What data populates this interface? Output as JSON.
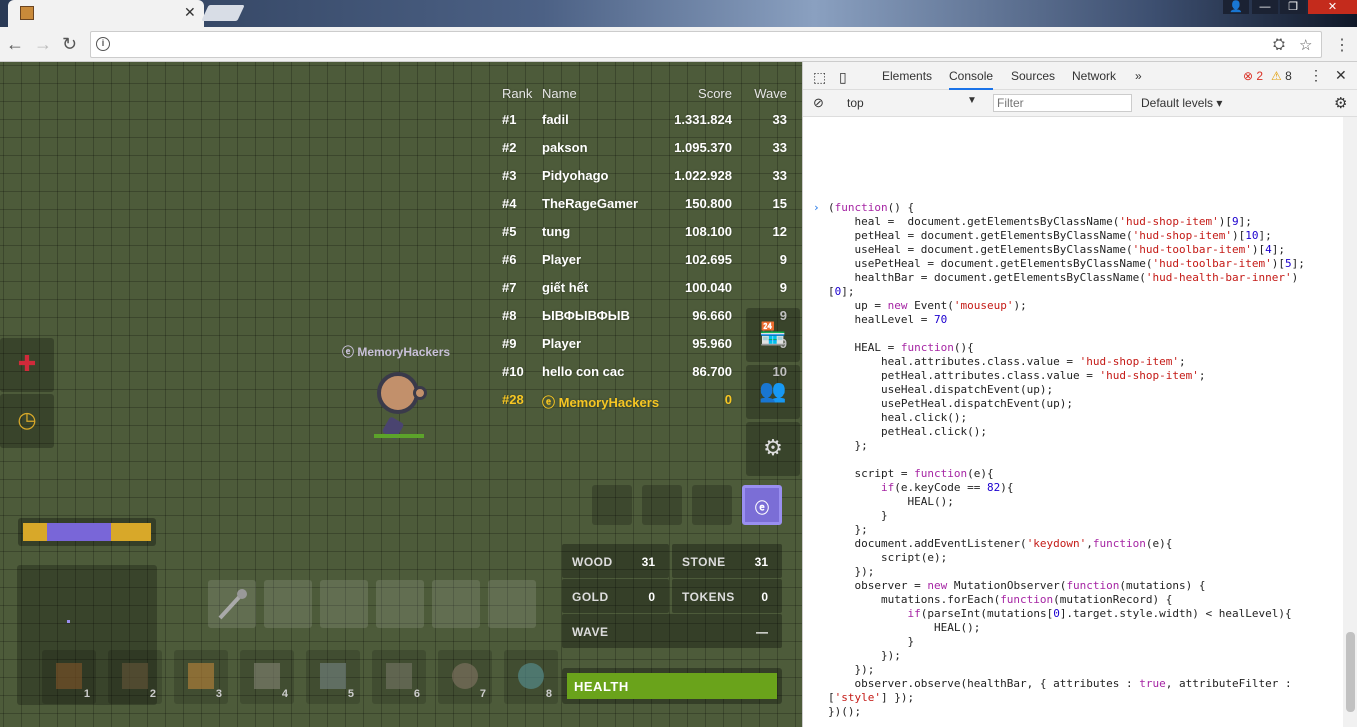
{
  "browser": {
    "tab_close": "✕",
    "window_controls": [
      "👤",
      "—",
      "❐",
      "✕"
    ],
    "nav": {
      "back": "←",
      "forward": "→",
      "reload": "↻"
    },
    "omni_info": "i",
    "translate_icon": "⛭",
    "star_icon": "☆",
    "menu_icon": "⋮"
  },
  "leaderboard": {
    "headers": {
      "rank": "Rank",
      "name": "Name",
      "score": "Score",
      "wave": "Wave"
    },
    "rows": [
      {
        "rank": "#1",
        "name": "fadil",
        "score": "1.331.824",
        "wave": "33"
      },
      {
        "rank": "#2",
        "name": "pakson",
        "score": "1.095.370",
        "wave": "33"
      },
      {
        "rank": "#3",
        "name": "Pidyohago",
        "score": "1.022.928",
        "wave": "33"
      },
      {
        "rank": "#4",
        "name": "TheRageGamer",
        "score": "150.800",
        "wave": "15"
      },
      {
        "rank": "#5",
        "name": "tung",
        "score": "108.100",
        "wave": "12"
      },
      {
        "rank": "#6",
        "name": "Player",
        "score": "102.695",
        "wave": "9"
      },
      {
        "rank": "#7",
        "name": "giết hết",
        "score": "100.040",
        "wave": "9"
      },
      {
        "rank": "#8",
        "name": "ЫВФЫВФЫВ",
        "score": "96.660",
        "wave": "9"
      },
      {
        "rank": "#9",
        "name": "Player",
        "score": "95.960",
        "wave": "9"
      },
      {
        "rank": "#10",
        "name": "hello con cac",
        "score": "86.700",
        "wave": "10"
      }
    ],
    "me": {
      "rank": "#28",
      "name": "ⓔ MemoryHackers",
      "score": "0",
      "wave": ""
    }
  },
  "player": {
    "name": "ⓔ MemoryHackers"
  },
  "side_icons": {
    "heal": "✚",
    "clock": "◷",
    "shop": "🏪",
    "party": "👥",
    "settings": "⚙"
  },
  "hud_active_slot": "ⓔ",
  "resources": {
    "wood_label": "WOOD",
    "wood_value": "31",
    "stone_label": "STONE",
    "stone_value": "31",
    "gold_label": "GOLD",
    "gold_value": "0",
    "tokens_label": "TOKENS",
    "tokens_value": "0",
    "wave_label": "WAVE",
    "wave_value": "—"
  },
  "health": {
    "label": "HEALTH",
    "level": 1.0
  },
  "xp": {
    "fill_purple": 0.48
  },
  "toolbar": [
    "1",
    "2",
    "3",
    "4",
    "5",
    "6",
    "7",
    "8"
  ],
  "devtools": {
    "tabs": [
      "Elements",
      "Console",
      "Sources",
      "Network"
    ],
    "more": "»",
    "errors": "2",
    "warnings": "8",
    "context": "top",
    "filter_placeholder": "Filter",
    "levels": "Default levels ▾",
    "prompt": "›"
  },
  "colors": {
    "accent": "#7b6ed6",
    "health": "#6aa31b",
    "gold": "#f6c623"
  }
}
